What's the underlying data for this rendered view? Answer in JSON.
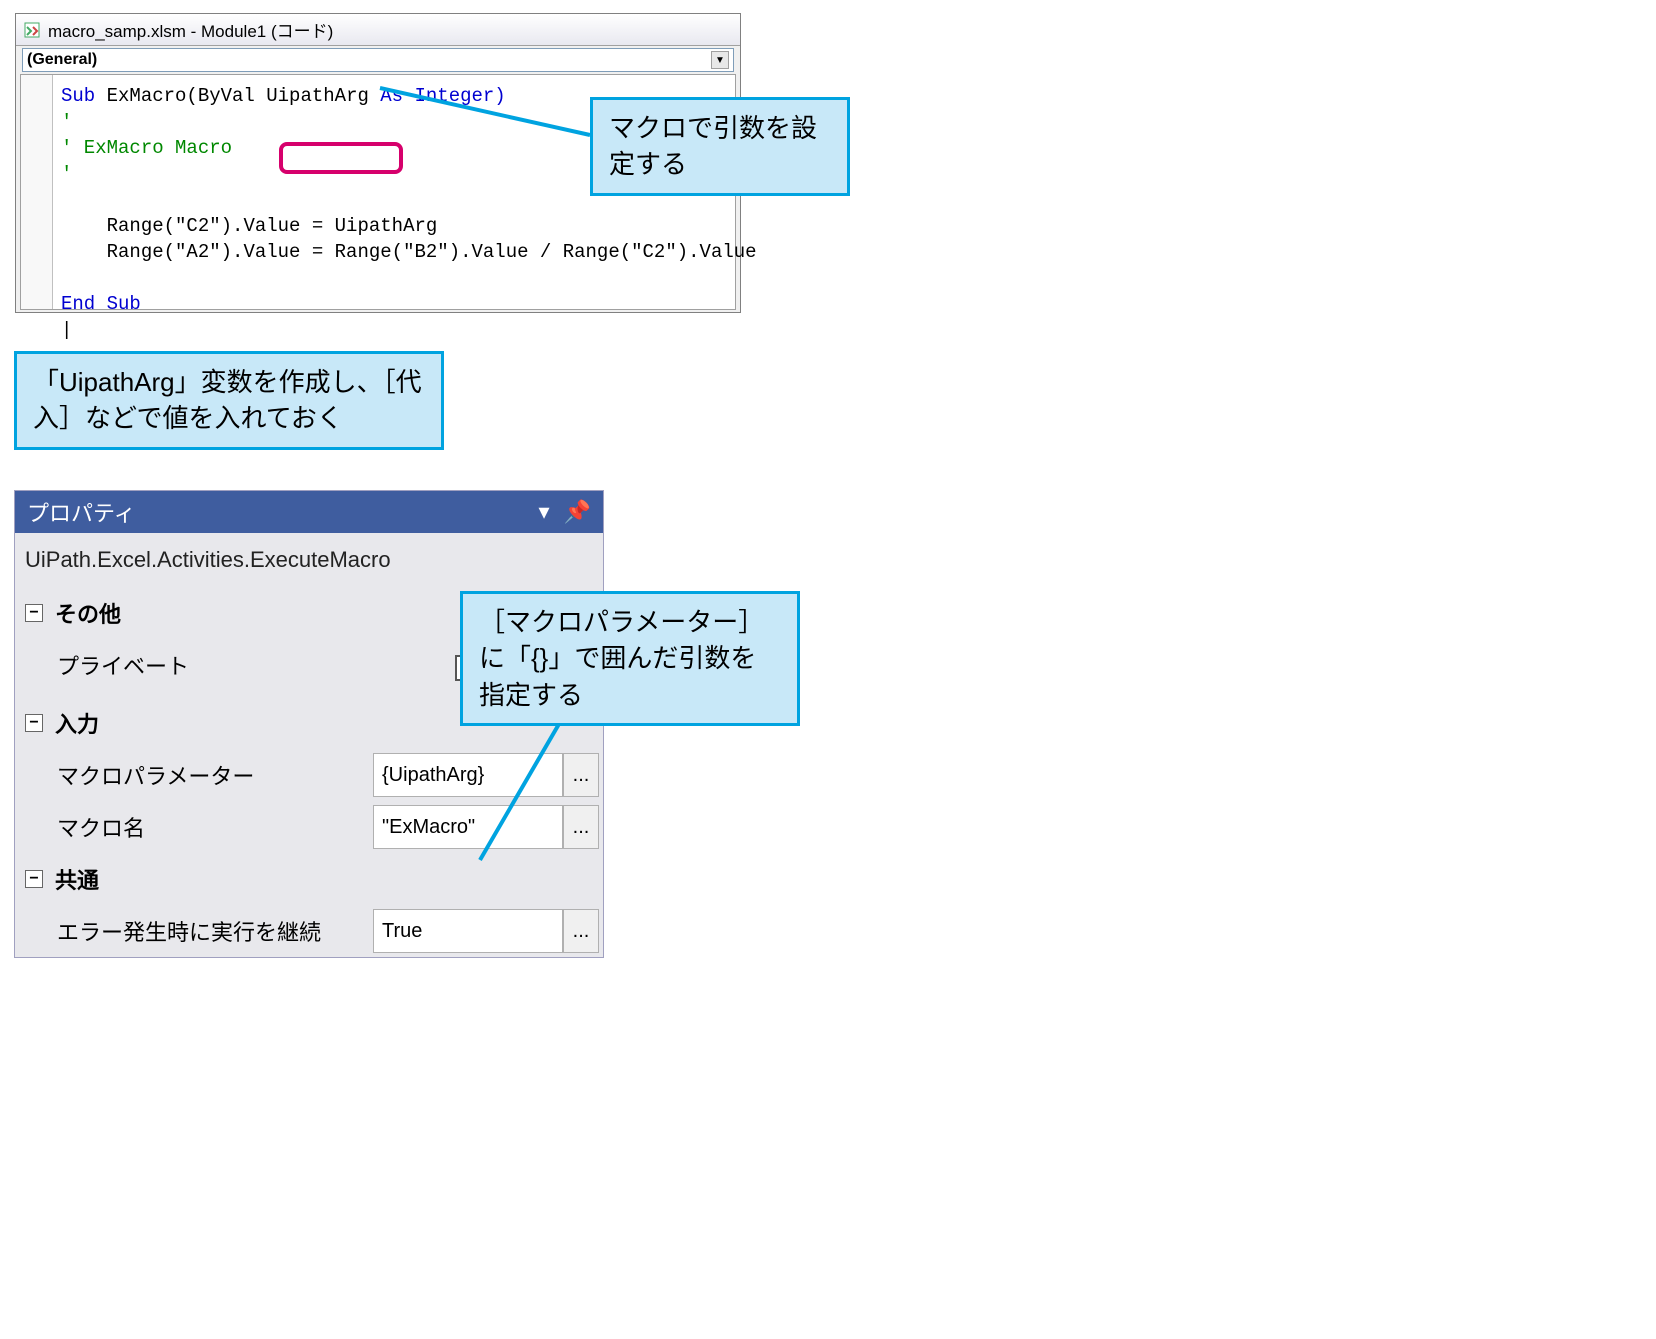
{
  "vba_window": {
    "title": "macro_samp.xlsm - Module1 (コード)",
    "dropdown_left": "(General)",
    "code": {
      "line1_sub": "Sub ",
      "line1_name": "ExMacro(ByVal ",
      "line1_arg": "UipathArg",
      "line1_rest": " As Integer)",
      "line2_comment_apostrophe": "'",
      "line3_comment": "' ExMacro Macro",
      "line4_comment_apostrophe": "'",
      "line6a": "    Range(",
      "line6b": "\"C2\"",
      "line6c": ").Value = UipathArg",
      "line7a": "    Range(",
      "line7b": "\"A2\"",
      "line7c": ").Value = Range(",
      "line7d": "\"B2\"",
      "line7e": ").Value / Range(",
      "line7f": "\"C2\"",
      "line7g": ").Value",
      "line9": "End Sub"
    }
  },
  "callouts": {
    "c1": "マクロで引数を設定する",
    "c2": "「UipathArg」変数を作成し、［代入］などで値を入れておく",
    "c3": "［マクロパラメーター］に「{}」で囲んだ引数を指定する"
  },
  "properties": {
    "panel_title": "プロパティ",
    "activity_name": "UiPath.Excel.Activities.ExecuteMacro",
    "sections": {
      "misc": "その他",
      "input": "入力",
      "common": "共通"
    },
    "rows": {
      "private_label": "プライベート",
      "macro_param_label": "マクロパラメーター",
      "macro_param_value": "{UipathArg}",
      "macro_name_label": "マクロ名",
      "macro_name_value": "\"ExMacro\"",
      "continue_on_error_label": "エラー発生時に実行を継続",
      "continue_on_error_value": "True"
    },
    "ellipsis": "..."
  },
  "icons": {
    "dropdown_arrow": "▼",
    "pin": "⏣",
    "toggle_minus": "−"
  }
}
